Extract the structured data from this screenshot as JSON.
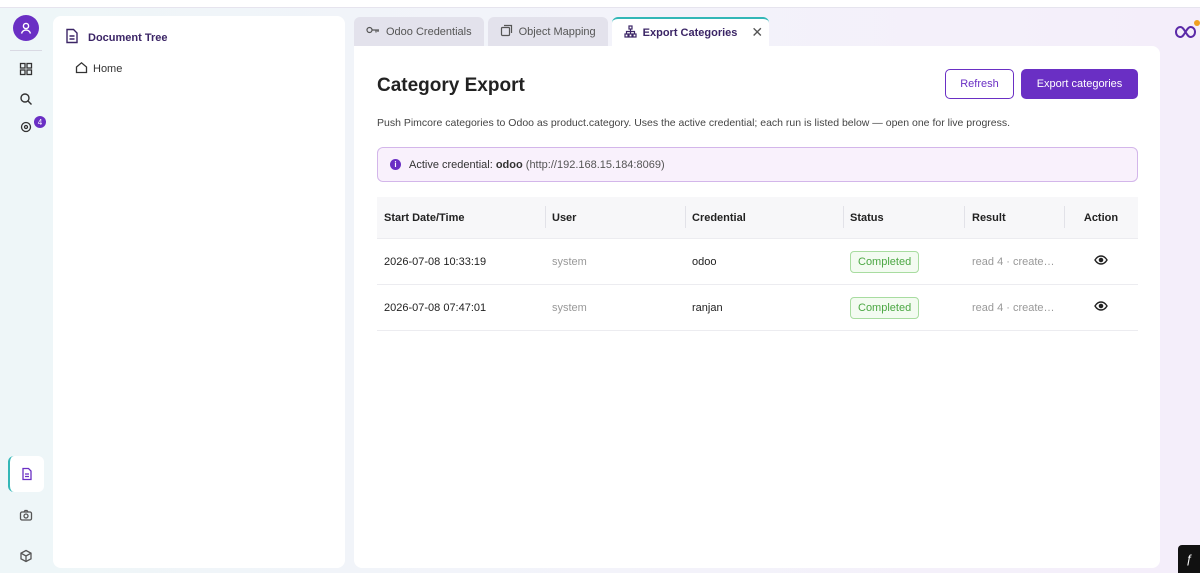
{
  "rail": {
    "badge_count": "4"
  },
  "tree": {
    "title": "Document Tree",
    "items": [
      {
        "label": "Home"
      }
    ]
  },
  "tabs": [
    {
      "label": "Odoo Credentials",
      "icon": "key-icon"
    },
    {
      "label": "Object Mapping",
      "icon": "layers-icon"
    },
    {
      "label": "Export Categories",
      "icon": "sitemap-icon",
      "active": true
    }
  ],
  "page": {
    "title": "Category Export",
    "description": "Push Pimcore categories to Odoo as product.category. Uses the active credential; each run is listed below — open one for live progress.",
    "refresh_label": "Refresh",
    "export_label": "Export categories"
  },
  "alert": {
    "prefix": "Active credential:",
    "name": "odoo",
    "url": "(http://192.168.15.184:8069)"
  },
  "table": {
    "headers": [
      "Start Date/Time",
      "User",
      "Credential",
      "Status",
      "Result",
      "Action"
    ],
    "rows": [
      {
        "start": "2026-07-08 10:33:19",
        "user": "system",
        "credential": "odoo",
        "status": "Completed",
        "result": "read 4 · create…"
      },
      {
        "start": "2026-07-08 07:47:01",
        "user": "system",
        "credential": "ranjan",
        "status": "Completed",
        "result": "read 4 · create…"
      }
    ]
  },
  "colors": {
    "accent": "#6a2fc4",
    "tab_highlight": "#33b7b7",
    "success": "#4ba743"
  }
}
